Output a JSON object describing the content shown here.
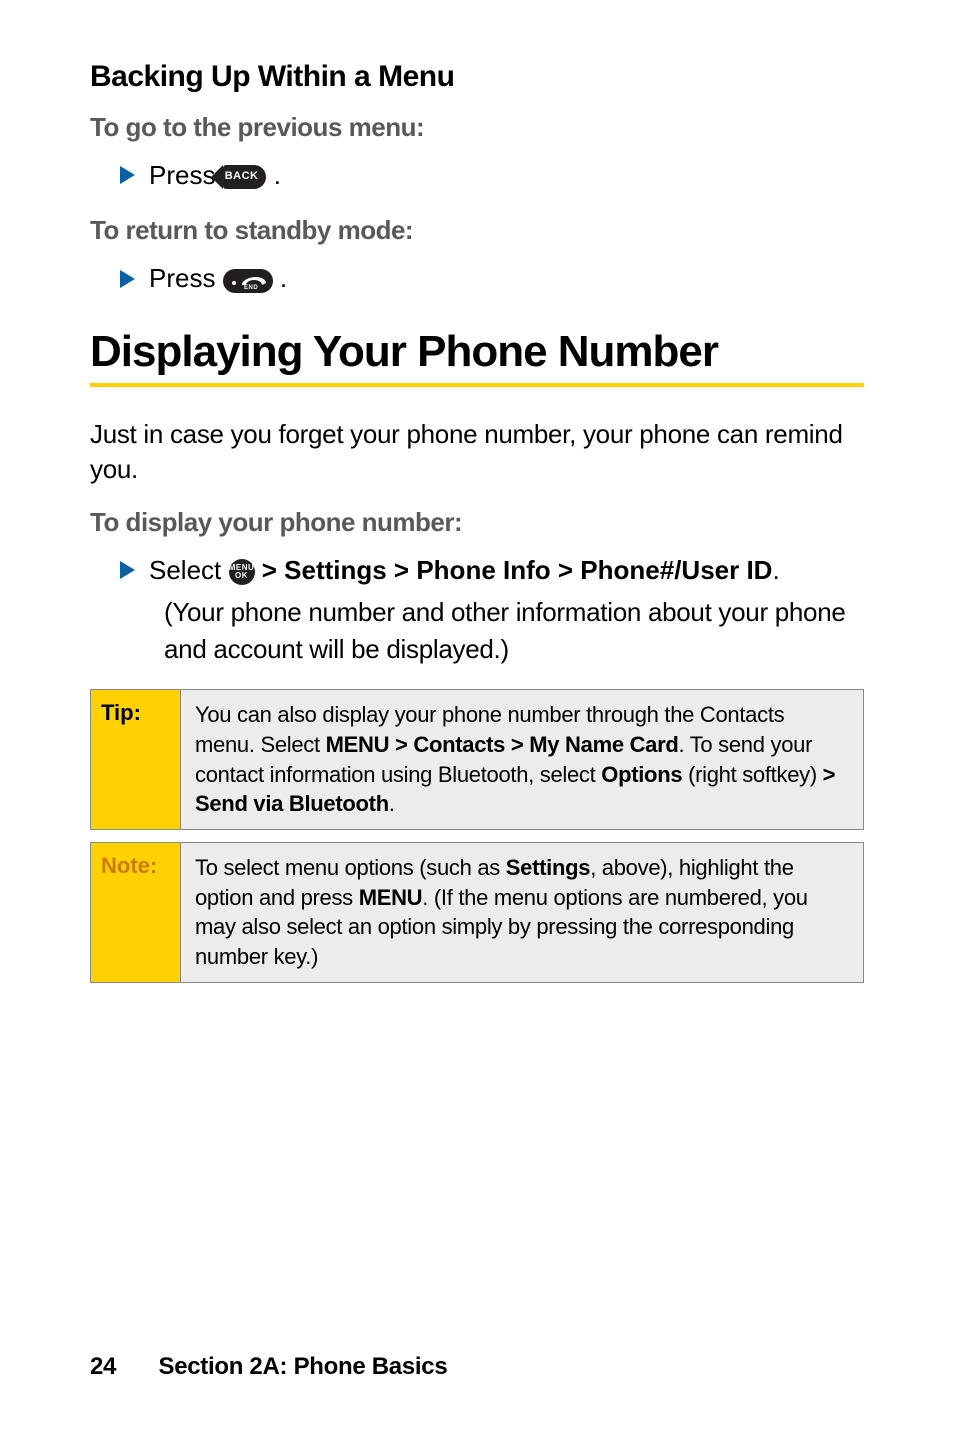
{
  "section_heading": "Backing Up Within a Menu",
  "go_prev_heading": "To go to the previous menu:",
  "press1_pre": "Press ",
  "press1_post": ".",
  "back_key_label": "BACK",
  "return_standby_heading": "To return to standby mode:",
  "press2_pre": "Press ",
  "press2_post": ".",
  "end_key_label": "END",
  "h1": "Displaying Your Phone Number",
  "intro_para": "Just in case you forget your phone number, your phone can remind you.",
  "display_heading": "To display your phone number:",
  "step_select_pre": "Select ",
  "menu_key_l1": "MENU",
  "menu_key_l2": "OK",
  "step_select_post_bold": " > Settings > Phone Info > Phone#/User ID",
  "step_select_post_plain": ".",
  "step_select_cont": "(Your phone number and other information about your phone and account will be displayed.)",
  "tip": {
    "label": "Tip:",
    "t1": "You can also display your phone number through the Contacts menu. Select ",
    "b1": "MENU > Contacts > My Name Card",
    "t2": ". To send your contact information using Bluetooth, select ",
    "b2": "Options ",
    "t3": "(right softkey) ",
    "b3": "> Send via Bluetooth",
    "t4": "."
  },
  "note": {
    "label": "Note:",
    "t1": "To select menu options (such as ",
    "b1": "Settings",
    "t2": ", above), highlight the option and press ",
    "b2": "MENU",
    "t3": ". (If the menu options are numbered, you may also select an option simply by pressing the corresponding number key.)"
  },
  "footer": {
    "page": "24",
    "section": "Section 2A: Phone Basics"
  }
}
